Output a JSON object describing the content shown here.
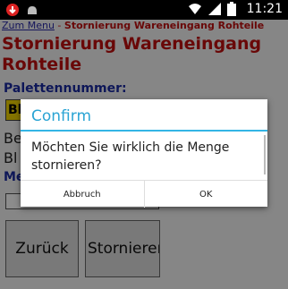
{
  "status_bar": {
    "time": "11:21",
    "icons": [
      "notification-red-icon",
      "android-icon",
      "wifi-icon",
      "signal-icon",
      "battery-icon"
    ]
  },
  "breadcrumb": {
    "home": "Zum Menu",
    "separator": " - ",
    "current": "Stornierung Wareneingang Rohteile"
  },
  "page": {
    "title": "Stornierung Wareneingang Rohteile",
    "pallet_label": "Palettennummer:",
    "pallet_value": "Bl",
    "row_be": "Be",
    "row_bl": "Bl",
    "row_me": "Me",
    "back_button": "Zurück",
    "cancel_button": "Stornieren"
  },
  "dialog": {
    "title": "Confirm",
    "message": "Möchten Sie wirklich die Menge stornieren?",
    "cancel": "Abbruch",
    "ok": "OK"
  },
  "colors": {
    "title_red": "#c01010",
    "label_blue": "#1a2aa0",
    "field_yellow": "#eed200",
    "dialog_accent": "#33b5e5"
  }
}
